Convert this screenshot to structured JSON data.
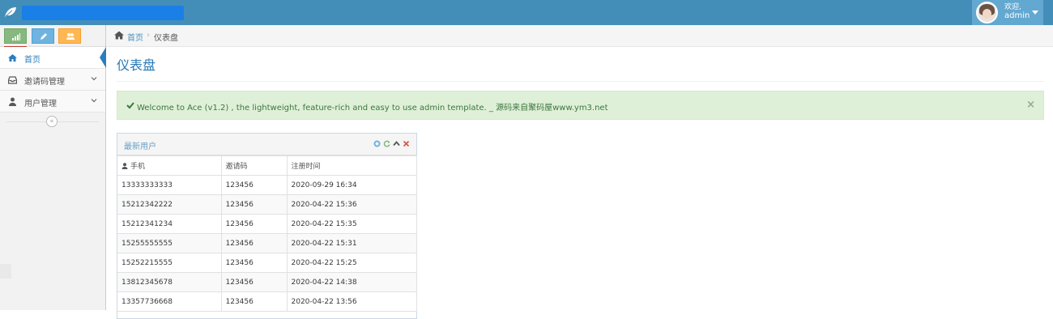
{
  "navbar": {
    "user": {
      "welcome": "欢迎,",
      "name": "admin"
    }
  },
  "sidebar": {
    "shortcuts": [
      {
        "icon": "signal-icon",
        "color": "#87b87f"
      },
      {
        "icon": "pencil-icon",
        "color": "#6fb3e0"
      },
      {
        "icon": "users-icon",
        "color": "#ffb752"
      },
      {
        "icon": "cogs-icon",
        "color": "#d15b47"
      }
    ],
    "items": [
      {
        "label": "首页",
        "icon": "home-icon",
        "active": true
      },
      {
        "label": "邀请码管理",
        "icon": "inbox-icon",
        "active": false
      },
      {
        "label": "用户管理",
        "icon": "user-icon",
        "active": false
      }
    ]
  },
  "breadcrumb": {
    "home": "首页",
    "separator": "›",
    "current": "仪表盘"
  },
  "page": {
    "title": "仪表盘"
  },
  "alert": {
    "text": "Welcome to Ace (v1.2) , the lightweight, feature-rich and easy to use admin template. _ 源码来自聚码屋www.ym3.net",
    "close": "×"
  },
  "widget": {
    "title": "最新用户",
    "columns": [
      "手机",
      "邀请码",
      "注册时间"
    ],
    "rows": [
      [
        "13333333333",
        "123456",
        "2020-09-29 16:34"
      ],
      [
        "15212342222",
        "123456",
        "2020-04-22 15:36"
      ],
      [
        "15212341234",
        "123456",
        "2020-04-22 15:35"
      ],
      [
        "15255555555",
        "123456",
        "2020-04-22 15:31"
      ],
      [
        "15252215555",
        "123456",
        "2020-04-22 15:25"
      ],
      [
        "13812345678",
        "123456",
        "2020-04-22 14:38"
      ],
      [
        "13357736668",
        "123456",
        "2020-04-22 13:56"
      ]
    ]
  },
  "colors": {
    "navbar": "#438eb9",
    "accent": "#2b7dbc",
    "alert_bg": "#dff0d8",
    "alert_text": "#3c763d"
  }
}
